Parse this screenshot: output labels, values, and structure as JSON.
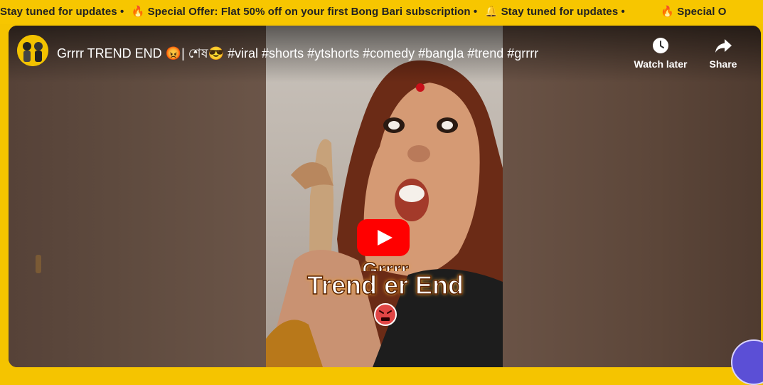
{
  "ticker": {
    "items": [
      "Stay tuned for updates •",
      "🔥 Special Offer: Flat 50% off on your first Bong Bari subscription •",
      "🔔 Stay tuned for updates •",
      "🔥 Special O"
    ]
  },
  "video": {
    "title": "Grrrr TREND END 😡| শেষ😎 #viral #shorts #ytshorts #comedy #bangla #trend #grrrr",
    "caption_line1": "Grrrr",
    "caption_line2": "Trend er End",
    "watch_later_label": "Watch later",
    "share_label": "Share"
  },
  "colors": {
    "ticker_bg": "#f7c600",
    "play_red": "#ff0000"
  }
}
